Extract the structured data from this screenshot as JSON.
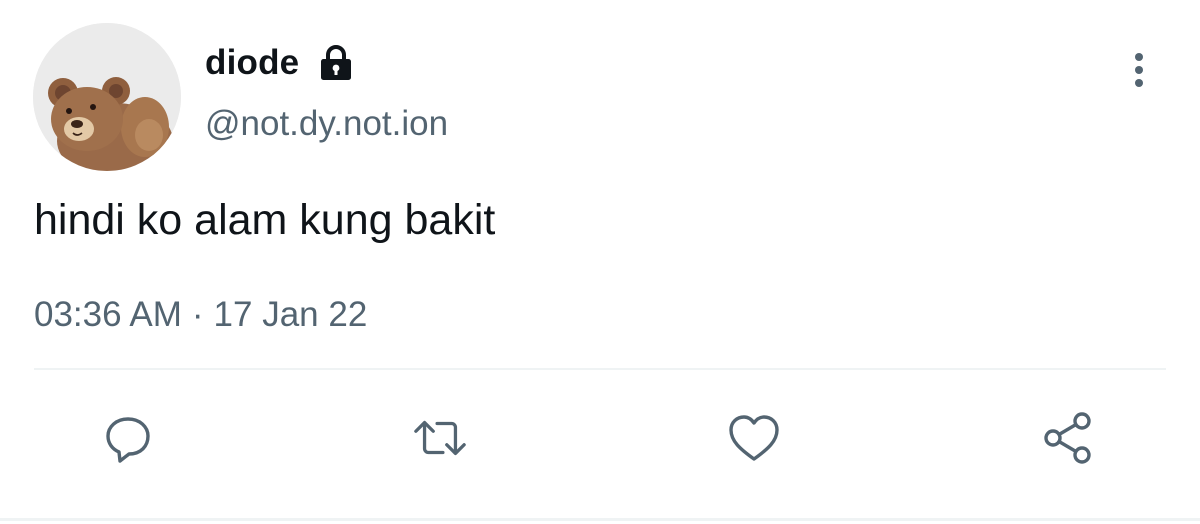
{
  "user": {
    "display_name": "diode",
    "handle": "@not.dy.not.ion",
    "avatar": "teddy-bear-photo",
    "protected_icon": "lock-icon"
  },
  "tweet": {
    "text": "hindi ko alam kung bakit",
    "time": "03:36 AM",
    "separator": "·",
    "date": "17 Jan 22"
  },
  "actions": [
    {
      "name": "reply",
      "icon": "reply-icon"
    },
    {
      "name": "retweet",
      "icon": "retweet-icon"
    },
    {
      "name": "like",
      "icon": "heart-icon"
    },
    {
      "name": "share",
      "icon": "share-icon"
    }
  ],
  "menu": {
    "icon": "more-vertical-icon"
  },
  "colors": {
    "text_primary": "#0f1419",
    "text_secondary": "#536471",
    "divider": "#eff3f4"
  }
}
